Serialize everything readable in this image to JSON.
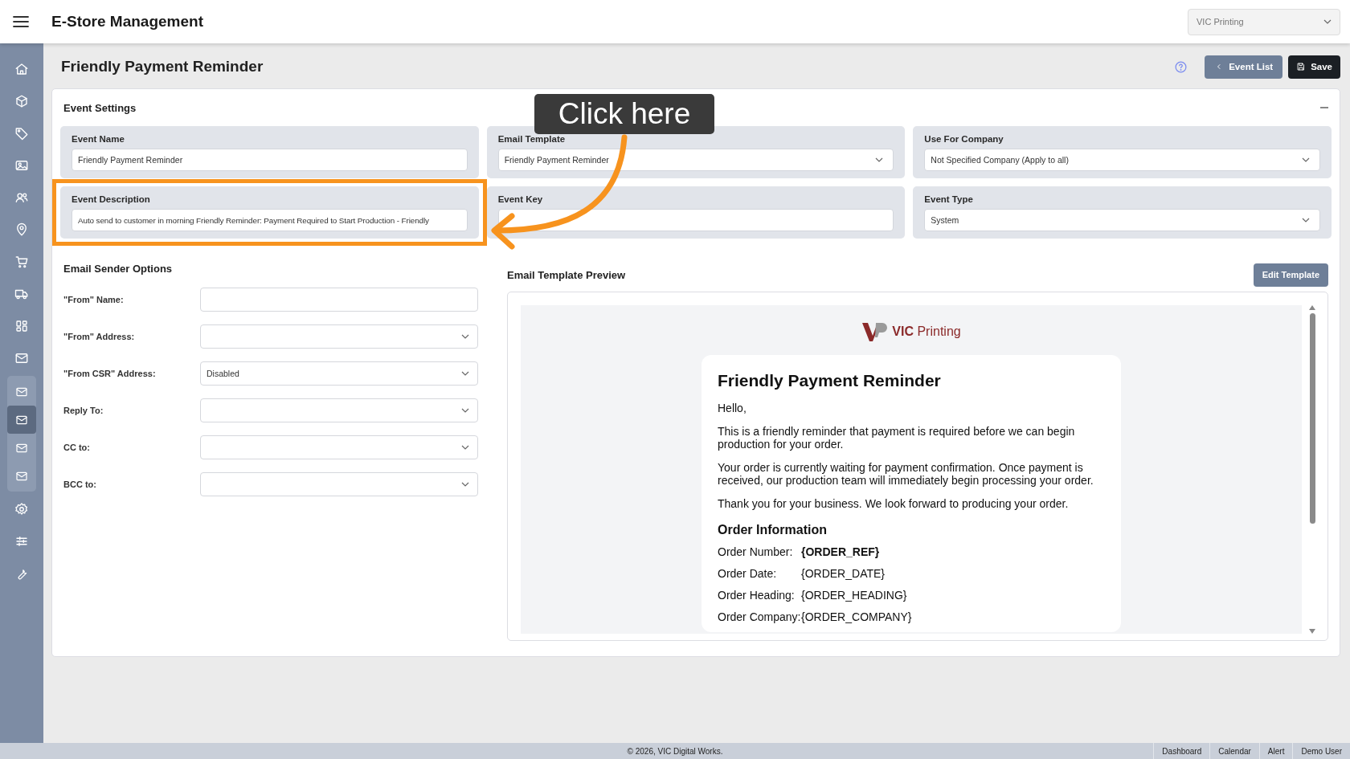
{
  "header": {
    "title": "E-Store Management",
    "company_select": "VIC Printing"
  },
  "sidebar": {
    "items": [
      {
        "selected": false
      },
      {
        "selected": false
      },
      {
        "selected": false
      },
      {
        "selected": false
      },
      {
        "selected": false
      },
      {
        "selected": false
      },
      {
        "selected": false
      },
      {
        "selected": false
      },
      {
        "selected": false
      },
      {
        "selected": false,
        "expanded": true,
        "children": [
          {
            "selected": false
          },
          {
            "selected": true
          },
          {
            "selected": false
          },
          {
            "selected": false
          }
        ]
      },
      {
        "selected": false
      },
      {
        "selected": false
      },
      {
        "selected": false
      }
    ]
  },
  "page": {
    "title": "Friendly Payment Reminder",
    "buttons": [
      {
        "label": "Event List",
        "kind": "back"
      },
      {
        "label": "Save",
        "kind": "save"
      }
    ]
  },
  "event_settings": {
    "title": "Event Settings",
    "fields": [
      {
        "label": "Event Name",
        "kind": "text",
        "value": "Friendly Payment Reminder",
        "highlighted": false
      },
      {
        "label": "Email Template",
        "kind": "select",
        "value": "Friendly Payment Reminder",
        "highlighted": false
      },
      {
        "label": "Use For Company",
        "kind": "select",
        "value": "Not Specified Company (Apply to all)",
        "highlighted": false
      },
      {
        "label": "Event Description",
        "kind": "text",
        "value": "Auto send to customer in morning Friendly Reminder: Payment Required to Start Production - Friendly",
        "highlighted": true
      },
      {
        "label": "Event Key",
        "kind": "text",
        "highlighted": false
      },
      {
        "label": "Event Type",
        "kind": "select",
        "value": "System",
        "highlighted": false
      }
    ]
  },
  "annotation": {
    "callout": "Click here"
  },
  "sender_options": {
    "title": "Email Sender Options",
    "fields": [
      {
        "label": "\"From\" Name:",
        "kind": "text"
      },
      {
        "label": "\"From\" Address:",
        "kind": "select"
      },
      {
        "label": "\"From CSR\" Address:",
        "kind": "select",
        "value": "Disabled"
      },
      {
        "label": "Reply To:",
        "kind": "select"
      },
      {
        "label": "CC to:",
        "kind": "select"
      },
      {
        "label": "BCC to:",
        "kind": "select"
      }
    ]
  },
  "preview": {
    "title": "Email Template Preview",
    "button": "Edit Template",
    "email": {
      "logo": "**VIC** Printing",
      "heading": "Friendly Payment Reminder",
      "paragraphs": [
        "Hello,",
        "This is a friendly reminder that payment is required before we can begin production for your order.",
        "Your order is currently waiting for payment confirmation. Once payment is received, our production team will immediately begin processing your order.",
        "Thank you for your business. We look forward to producing your order."
      ],
      "section_title": "Order Information",
      "info": [
        {
          "label": "Order Number:",
          "value": "{ORDER_REF}",
          "bold": true
        },
        {
          "label": "Order Date:",
          "value": "{ORDER_DATE}",
          "bold": false
        },
        {
          "label": "Order Heading:",
          "value": "{ORDER_HEADING}",
          "bold": false
        },
        {
          "label": "Order Company:",
          "value": "{ORDER_COMPANY}",
          "bold": false
        }
      ]
    }
  },
  "footer": {
    "copyright": "© 2026, VIC Digital Works.",
    "links": [
      "Dashboard",
      "Calendar",
      "Alert",
      "Demo User"
    ]
  }
}
